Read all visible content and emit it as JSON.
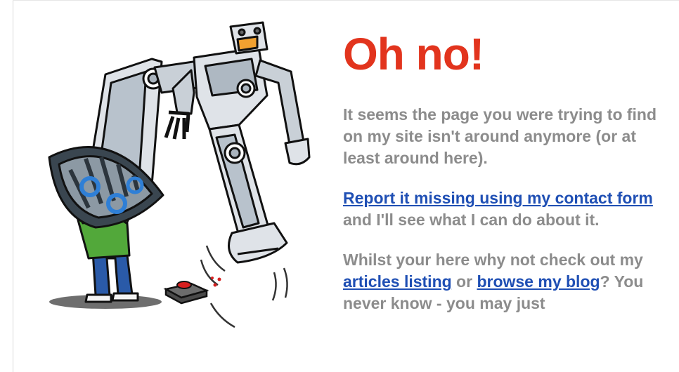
{
  "heading": "Oh no!",
  "paragraph1": "It seems the page you were trying to find on my site isn't around anymore (or at least around here).",
  "paragraph2": {
    "link": "Report it missing using my contact form",
    "text": " and I'll see what I can do about it."
  },
  "paragraph3": {
    "text_start": "Whilst your here why not check out my ",
    "link_articles": "articles listing",
    "text_or": " or ",
    "link_blog": "browse my blog",
    "text_end": "? You never know - you may just"
  },
  "colors": {
    "heading": "#e2341d",
    "body_text": "#8c8c8c",
    "link": "#1f4fb4"
  },
  "icons": [
    "robot-illustration",
    "red-button-icon"
  ]
}
